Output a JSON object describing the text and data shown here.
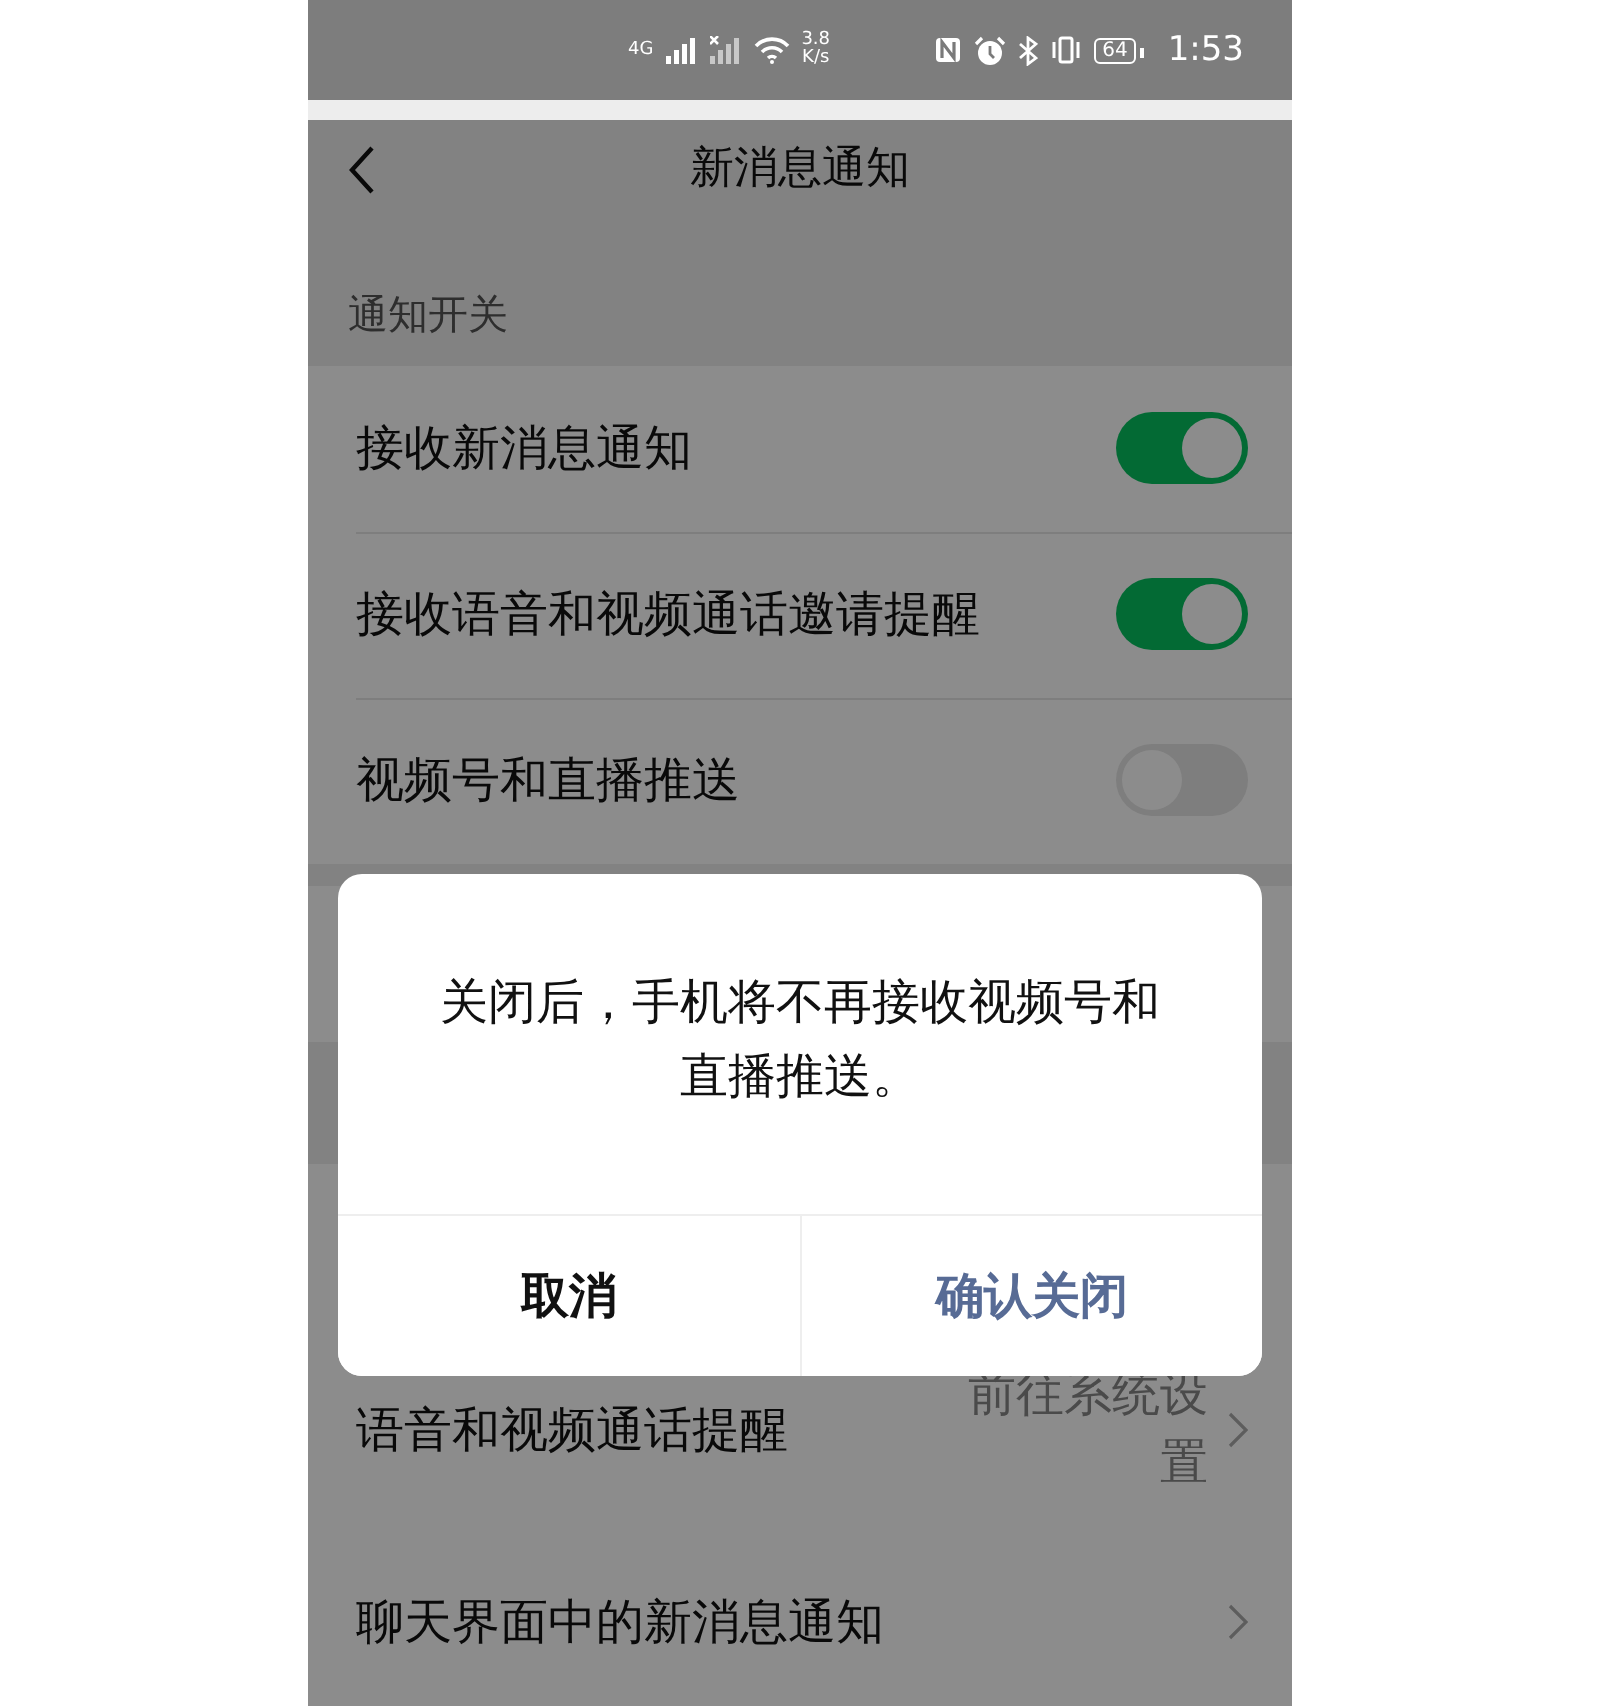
{
  "status_bar": {
    "network": "4G",
    "speed_value": "3.8",
    "speed_unit": "K/s",
    "battery": "64",
    "time": "1:53"
  },
  "nav": {
    "title": "新消息通知"
  },
  "notification_section": {
    "header": "通知开关",
    "rows": [
      {
        "label": "接收新消息通知",
        "on": true
      },
      {
        "label": "接收语音和视频通话邀请提醒",
        "on": true
      },
      {
        "label": "视频号和直播推送",
        "on": false
      }
    ]
  },
  "link_rows": [
    {
      "label": "语音和视频通话提醒",
      "value": "前往系统设置"
    },
    {
      "label": "聊天界面中的新消息通知"
    }
  ],
  "dialog": {
    "message": "关闭后，手机将不再接收视频号和直播推送。",
    "buttons": [
      {
        "label": "取消",
        "kind": "cancel"
      },
      {
        "label": "确认关闭",
        "kind": "confirm"
      }
    ]
  }
}
